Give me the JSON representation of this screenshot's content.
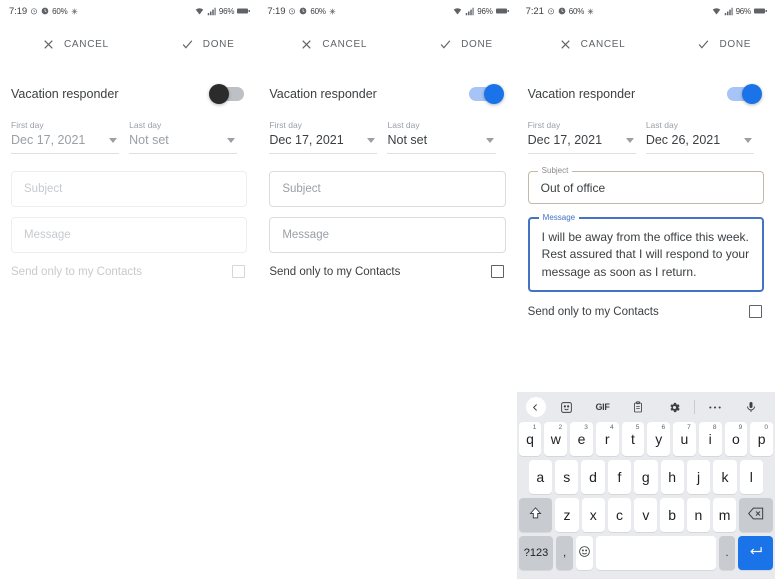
{
  "app": {
    "title": "Gmail Vacation responder settings"
  },
  "panels": [
    {
      "id": "panel-disabled",
      "status": {
        "time": "7:19",
        "battery": "96%"
      },
      "actions": {
        "cancel": "CANCEL",
        "done": "DONE"
      },
      "responder": {
        "label": "Vacation responder",
        "enabled": false
      },
      "dates": {
        "first_caption": "First day",
        "first_value": "Dec 17, 2021",
        "last_caption": "Last day",
        "last_value": "Not set"
      },
      "subject": {
        "placeholder": "Subject",
        "value": ""
      },
      "message": {
        "placeholder": "Message",
        "value": ""
      },
      "contacts": {
        "label": "Send only to my Contacts",
        "checked": false
      },
      "keyboard_visible": false
    },
    {
      "id": "panel-enabled-empty",
      "status": {
        "time": "7:19",
        "battery": "96%"
      },
      "actions": {
        "cancel": "CANCEL",
        "done": "DONE"
      },
      "responder": {
        "label": "Vacation responder",
        "enabled": true
      },
      "dates": {
        "first_caption": "First day",
        "first_value": "Dec 17, 2021",
        "last_caption": "Last day",
        "last_value": "Not set"
      },
      "subject": {
        "placeholder": "Subject",
        "value": ""
      },
      "message": {
        "placeholder": "Message",
        "value": ""
      },
      "contacts": {
        "label": "Send only to my Contacts",
        "checked": false
      },
      "keyboard_visible": false
    },
    {
      "id": "panel-filled",
      "status": {
        "time": "7:21",
        "battery": "96%"
      },
      "actions": {
        "cancel": "CANCEL",
        "done": "DONE"
      },
      "responder": {
        "label": "Vacation responder",
        "enabled": true
      },
      "dates": {
        "first_caption": "First day",
        "first_value": "Dec 17, 2021",
        "last_caption": "Last day",
        "last_value": "Dec 26, 2021"
      },
      "subject": {
        "label": "Subject",
        "value": "Out of office"
      },
      "message": {
        "label": "Message",
        "value": "I will be away from the office this week. Rest assured that I will respond to your message as soon as I return."
      },
      "contacts": {
        "label": "Send only to my Contacts",
        "checked": false
      },
      "keyboard_visible": true
    }
  ],
  "keyboard": {
    "toolbar": [
      "back-icon",
      "sticker-icon",
      "GIF",
      "clipboard-icon",
      "settings-icon",
      "more-icon",
      "mic-icon"
    ],
    "gif_label": "GIF",
    "row1": [
      {
        "k": "q",
        "n": "1"
      },
      {
        "k": "w",
        "n": "2"
      },
      {
        "k": "e",
        "n": "3"
      },
      {
        "k": "r",
        "n": "4"
      },
      {
        "k": "t",
        "n": "5"
      },
      {
        "k": "y",
        "n": "6"
      },
      {
        "k": "u",
        "n": "7"
      },
      {
        "k": "i",
        "n": "8"
      },
      {
        "k": "o",
        "n": "9"
      },
      {
        "k": "p",
        "n": "0"
      }
    ],
    "row2": [
      "a",
      "s",
      "d",
      "f",
      "g",
      "h",
      "j",
      "k",
      "l"
    ],
    "row3": [
      "z",
      "x",
      "c",
      "v",
      "b",
      "n",
      "m"
    ],
    "shift_label": "shift-icon",
    "backspace_label": "backspace-icon",
    "num_label": "?123",
    "comma_label": ",",
    "emoji_label": "emoji-icon",
    "space_label": "",
    "period_label": ".",
    "enter_label": "enter-icon"
  },
  "colors": {
    "accent": "#1a73e8",
    "toggle_track_on": "#a6c4f5",
    "focus_border": "#4472c4",
    "key_bg": "#ffffff",
    "keyboard_bg": "#e8eaed"
  }
}
